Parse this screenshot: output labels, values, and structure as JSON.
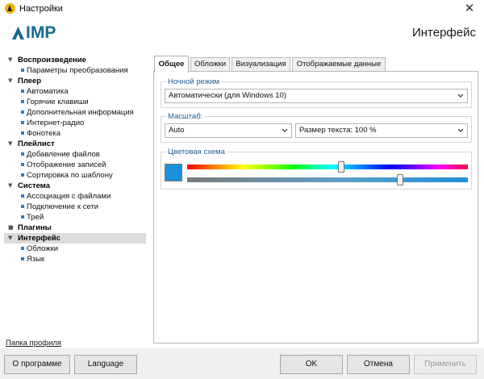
{
  "window": {
    "title": "Настройки",
    "close_glyph": "✕"
  },
  "header": {
    "logo_text": "IMP",
    "page_title": "Интерфейс"
  },
  "sidebar": {
    "items": [
      {
        "label": "Воспроизведение",
        "level": 0
      },
      {
        "label": "Параметры преобразования",
        "level": 1
      },
      {
        "label": "Плеер",
        "level": 0
      },
      {
        "label": "Автоматика",
        "level": 1
      },
      {
        "label": "Горячие клавиши",
        "level": 1
      },
      {
        "label": "Дополнительная информация",
        "level": 1
      },
      {
        "label": "Интернет-радио",
        "level": 1
      },
      {
        "label": "Фонотека",
        "level": 1
      },
      {
        "label": "Плейлист",
        "level": 0
      },
      {
        "label": "Добавление файлов",
        "level": 1
      },
      {
        "label": "Отображение записей",
        "level": 1
      },
      {
        "label": "Сортировка по шаблону",
        "level": 1
      },
      {
        "label": "Система",
        "level": 0
      },
      {
        "label": "Ассоциация с файлами",
        "level": 1
      },
      {
        "label": "Подключение к сети",
        "level": 1
      },
      {
        "label": "Трей",
        "level": 1
      },
      {
        "label": "Плагины",
        "level": 0
      },
      {
        "label": "Интерфейс",
        "level": 0,
        "selected": true
      },
      {
        "label": "Обложки",
        "level": 1
      },
      {
        "label": "Язык",
        "level": 1
      }
    ],
    "profile_link": "Папка профиля"
  },
  "tabs": [
    {
      "label": "Общее",
      "active": true
    },
    {
      "label": "Обложки"
    },
    {
      "label": "Визуализация"
    },
    {
      "label": "Отображаемые данные"
    }
  ],
  "night_mode": {
    "legend": "Ночной режим",
    "value": "Автоматически (для Windows 10)"
  },
  "scale": {
    "legend": "Масштаб:",
    "scale_value": "Auto",
    "text_size_value": "Размер текста: 100 %"
  },
  "color_scheme": {
    "legend": "Цветовая схема",
    "swatch_color": "#1e90d8",
    "hue_position": 0.55,
    "saturation_position": 0.76
  },
  "footer": {
    "about_label": "О программе",
    "language_label": "Language",
    "ok_label": "OK",
    "cancel_label": "Отмена",
    "apply_label": "Применить"
  },
  "colors": {
    "accent": "#1e90d8",
    "brand": "#1b6a8f",
    "legend_text": "#1f5a96",
    "app_icon": "#f3b300"
  }
}
